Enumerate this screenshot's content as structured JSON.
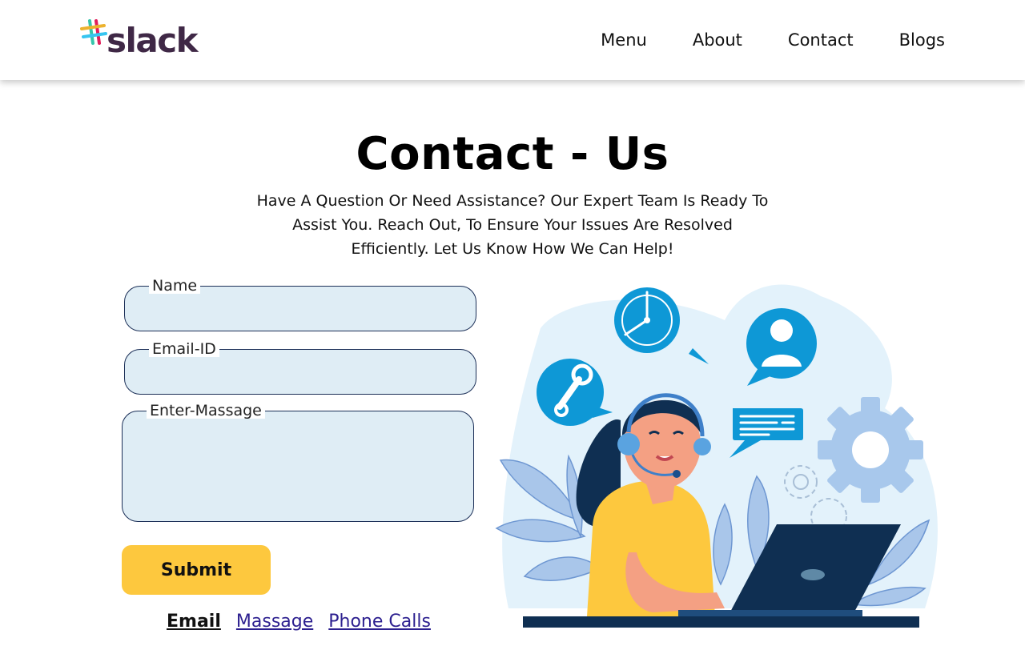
{
  "brand": {
    "name": "slack"
  },
  "nav": {
    "items": [
      "Menu",
      "About",
      "Contact",
      "Blogs"
    ]
  },
  "hero": {
    "title": "Contact - Us",
    "subtitle": "Have A Question Or Need Assistance? Our Expert Team Is Ready To Assist You. Reach Out, To Ensure Your Issues Are Resolved Efficiently. Let Us Know How We Can Help!"
  },
  "form": {
    "name_label": "Name",
    "name_value": "",
    "email_label": "Email-ID",
    "email_value": "",
    "message_label": "Enter-Massage",
    "message_value": "",
    "submit_label": "Submit"
  },
  "contact_methods": {
    "items": [
      "Email",
      "Massage",
      "Phone Calls"
    ],
    "active": "Email"
  },
  "colors": {
    "accent": "#fdc83e",
    "field_bg": "#dfedf5",
    "field_border": "#1c2f57",
    "link": "#2c1f8f",
    "illustration_blue": "#0e98d6"
  },
  "icons": [
    "slack-logo-icon",
    "clock-icon",
    "user-icon",
    "wrench-icon",
    "chat-icon",
    "gear-icon",
    "laptop-icon"
  ]
}
